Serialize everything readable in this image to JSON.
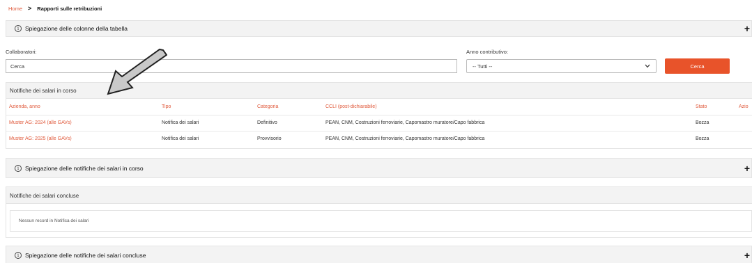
{
  "breadcrumb": {
    "home": "Home",
    "separator": ">",
    "current": "Rapporti sulle retribuzioni"
  },
  "panels": {
    "columns_explanation": "Spiegazione delle colonne della tabella",
    "ongoing_explanation": "Spiegazione delle notifiche dei salari in corso",
    "concluded_explanation": "Spiegazione delle notifiche dei salari concluse",
    "info_glyph": "i",
    "plus_glyph": "+"
  },
  "filters": {
    "collaborators_label": "Collaboratori:",
    "collaborators_value": "Cerca",
    "year_label": "Anno contributivo:",
    "year_value": "-- Tutti --",
    "search_button": "Cerca"
  },
  "ongoing": {
    "title": "Notifiche dei salari in corso",
    "columns": [
      "Azienda, anno",
      "Tipo",
      "Categoria",
      "CCLI (post-dichiarabile)",
      "Stato",
      "Azio"
    ],
    "rows": [
      [
        "Muster AG: 2024 (alle GAVs)",
        "Notifica dei salari",
        "Definitivo",
        "PEAN, CNM, Costruzioni ferroviarie, Capomastro muratore/Capo fabbrica",
        "Bozza",
        ""
      ],
      [
        "Muster AG: 2025 (alle GAVs)",
        "Notifica dei salari",
        "Provvisorio",
        "PEAN, CNM, Costruzioni ferroviarie, Capomastro muratore/Capo fabbrica",
        "Bozza",
        ""
      ]
    ]
  },
  "concluded": {
    "title": "Notifiche dei salari concluse",
    "empty_message": "Nessun record in Notifica dei salari"
  },
  "colors": {
    "accent": "#e8532a",
    "link": "#e05a3c",
    "arrow_fill": "#c9c9c9"
  },
  "annotation": {
    "icon": "arrow-pointer-icon"
  }
}
